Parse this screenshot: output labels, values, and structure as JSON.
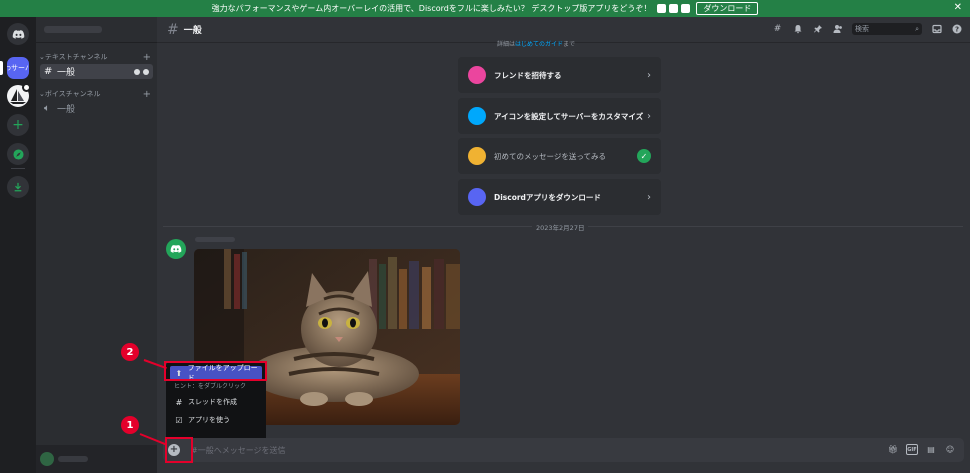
{
  "banner": {
    "text": "強力なパフォーマンスやゲーム内オーバーレイの活用で、Discordをフルに楽しみたい？ デスクトップ版アプリをどうぞ！",
    "button": "ダウンロード",
    "close": "✕"
  },
  "rail": {
    "server_name": "わサーバ"
  },
  "sidebar": {
    "text_category": "テキストチャンネル",
    "text_channel": "一般",
    "voice_category": "ボイスチャンネル",
    "voice_channel": "一般"
  },
  "topbar": {
    "channel": "一般",
    "search_placeholder": "検索"
  },
  "intro_hint": {
    "prefix": "詳細は",
    "link": "はじめてのガイド",
    "suffix": "まで"
  },
  "tasks": [
    {
      "label": "フレンドを招待する",
      "done": false,
      "icon_color": "#eb459e"
    },
    {
      "label": "アイコンを設定してサーバーをカスタマイズ",
      "done": false,
      "icon_color": "#00a8fc"
    },
    {
      "label": "初めてのメッセージを送ってみる",
      "done": true,
      "icon_color": "#f0b232"
    },
    {
      "label": "Discordアプリをダウンロード",
      "done": false,
      "icon_color": "#5865f2"
    }
  ],
  "date_divider": "2023年2月27日",
  "popup": {
    "upload": "ファイルをアップロード",
    "hint": "ヒント：をダブルクリック",
    "thread": "スレッドを作成",
    "apps": "アプリを使う"
  },
  "composer": {
    "placeholder": "#一般へメッセージを送信"
  },
  "callouts": {
    "one": "1",
    "two": "2"
  },
  "colors": {
    "accent": "#5865f2",
    "banner": "#248046",
    "callout": "#e4002b"
  }
}
